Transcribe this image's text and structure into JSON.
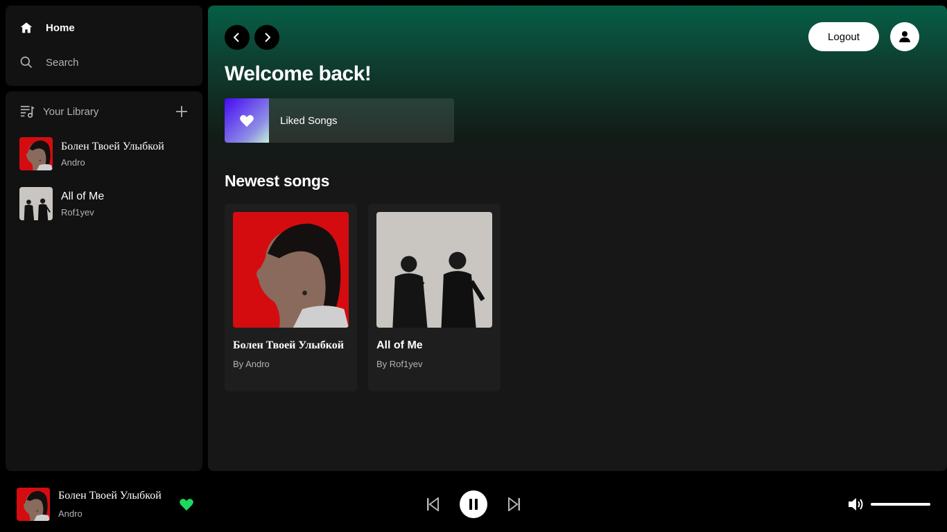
{
  "sidebar": {
    "nav": {
      "home": "Home",
      "search": "Search"
    },
    "library": {
      "title": "Your Library",
      "items": [
        {
          "title": "Болен Твоей Улыбкой",
          "artist": "Andro"
        },
        {
          "title": "All of Me",
          "artist": "Rof1yev"
        }
      ]
    }
  },
  "header": {
    "logout_label": "Logout"
  },
  "main": {
    "welcome": "Welcome back!",
    "liked_songs": "Liked Songs",
    "newest_title": "Newest songs",
    "cards": [
      {
        "title": "Болен Твоей Улыбкой",
        "by": "By Andro"
      },
      {
        "title": "All of Me",
        "by": "By Rof1yev"
      }
    ]
  },
  "player": {
    "title": "Болен Твоей Улыбкой",
    "artist": "Andro",
    "liked": true,
    "volume": 1.0
  },
  "colors": {
    "accent": "#1ed760",
    "header_gradient": "#065f46",
    "background": "#121212"
  }
}
